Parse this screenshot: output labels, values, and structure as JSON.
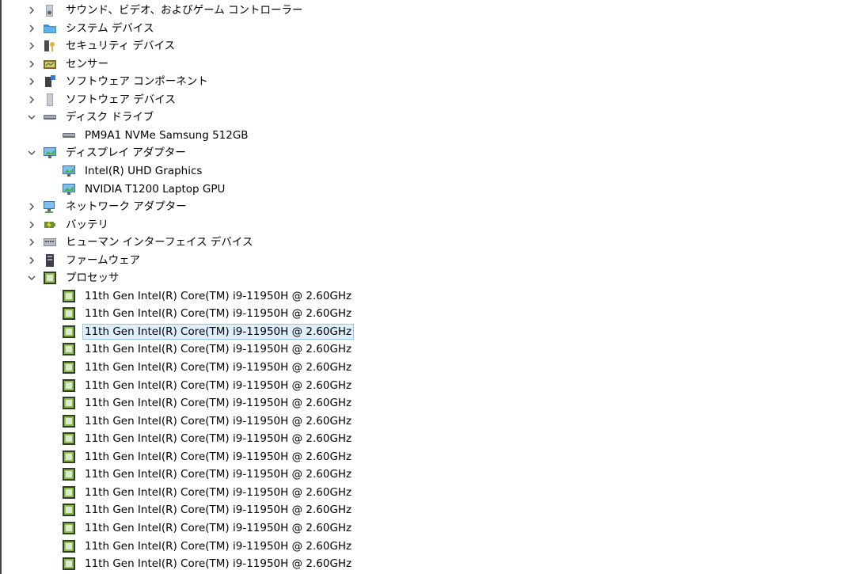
{
  "categories_top": [
    {
      "label": "サウンド、ビデオ、およびゲーム コントローラー",
      "icon": "speaker-icon",
      "expanded": false
    },
    {
      "label": "システム デバイス",
      "icon": "system-folder-icon",
      "expanded": false
    },
    {
      "label": "セキュリティ デバイス",
      "icon": "security-key-icon",
      "expanded": false
    },
    {
      "label": "センサー",
      "icon": "sensor-icon",
      "expanded": false
    },
    {
      "label": "ソフトウェア コンポーネント",
      "icon": "software-component-icon",
      "expanded": false
    },
    {
      "label": "ソフトウェア デバイス",
      "icon": "software-device-icon",
      "expanded": false
    }
  ],
  "disk": {
    "label": "ディスク ドライブ",
    "icon": "disk-drive-icon",
    "expanded": true,
    "children": [
      "PM9A1 NVMe Samsung 512GB"
    ]
  },
  "display": {
    "label": "ディスプレイ アダプター",
    "icon": "display-adapter-icon",
    "expanded": true,
    "children": [
      "Intel(R) UHD Graphics",
      "NVIDIA T1200 Laptop GPU"
    ]
  },
  "categories_mid": [
    {
      "label": "ネットワーク アダプター",
      "icon": "network-icon",
      "expanded": false
    },
    {
      "label": "バッテリ",
      "icon": "battery-icon",
      "expanded": false
    },
    {
      "label": "ヒューマン インターフェイス デバイス",
      "icon": "hid-icon",
      "expanded": false
    },
    {
      "label": "ファームウェア",
      "icon": "firmware-icon",
      "expanded": false
    }
  ],
  "processor": {
    "label": "プロセッサ",
    "icon": "processor-icon",
    "expanded": true,
    "children": [
      "11th Gen Intel(R) Core(TM) i9-11950H @ 2.60GHz",
      "11th Gen Intel(R) Core(TM) i9-11950H @ 2.60GHz",
      "11th Gen Intel(R) Core(TM) i9-11950H @ 2.60GHz",
      "11th Gen Intel(R) Core(TM) i9-11950H @ 2.60GHz",
      "11th Gen Intel(R) Core(TM) i9-11950H @ 2.60GHz",
      "11th Gen Intel(R) Core(TM) i9-11950H @ 2.60GHz",
      "11th Gen Intel(R) Core(TM) i9-11950H @ 2.60GHz",
      "11th Gen Intel(R) Core(TM) i9-11950H @ 2.60GHz",
      "11th Gen Intel(R) Core(TM) i9-11950H @ 2.60GHz",
      "11th Gen Intel(R) Core(TM) i9-11950H @ 2.60GHz",
      "11th Gen Intel(R) Core(TM) i9-11950H @ 2.60GHz",
      "11th Gen Intel(R) Core(TM) i9-11950H @ 2.60GHz",
      "11th Gen Intel(R) Core(TM) i9-11950H @ 2.60GHz",
      "11th Gen Intel(R) Core(TM) i9-11950H @ 2.60GHz",
      "11th Gen Intel(R) Core(TM) i9-11950H @ 2.60GHz",
      "11th Gen Intel(R) Core(TM) i9-11950H @ 2.60GHz"
    ],
    "selected_index": 2
  }
}
